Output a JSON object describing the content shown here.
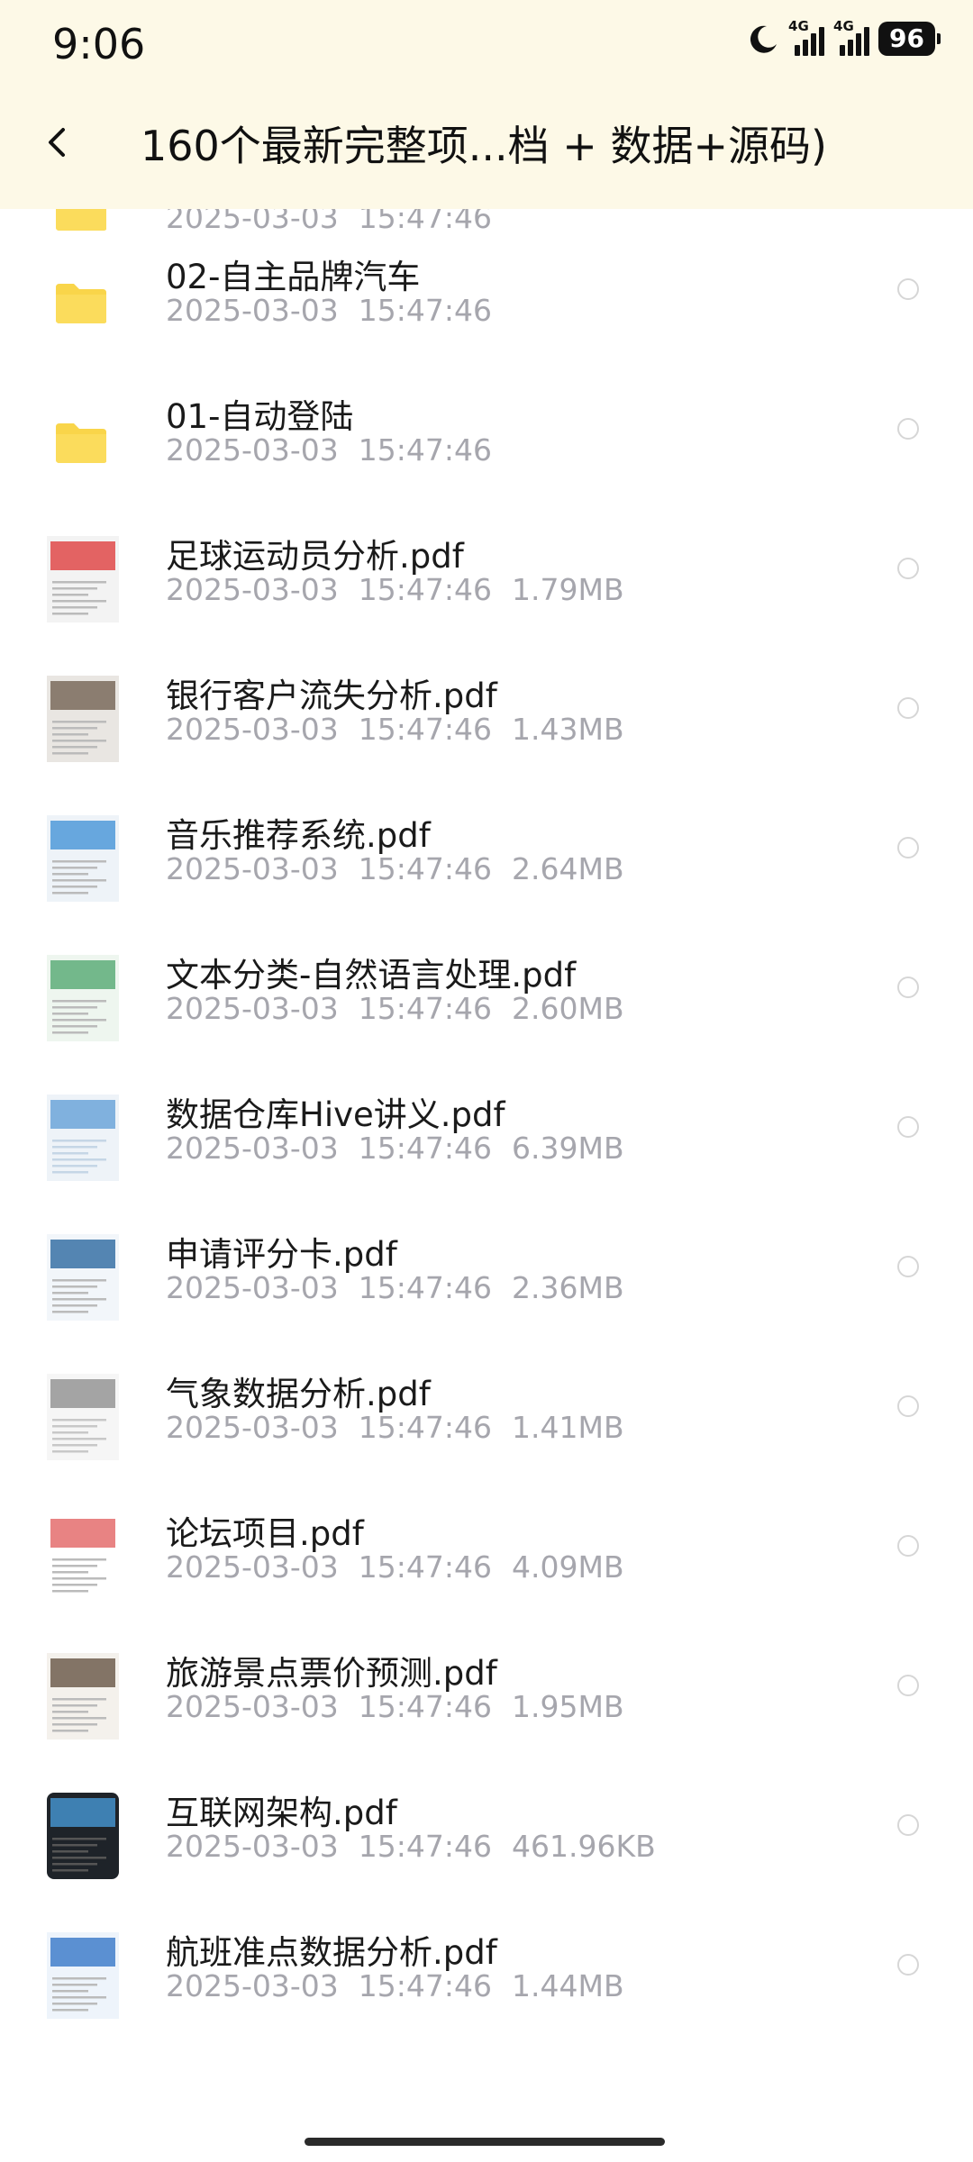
{
  "status_bar": {
    "time": "9:06",
    "signal1_label": "4G",
    "signal2_label": "4G",
    "battery": "96"
  },
  "header": {
    "title": "160个最新完整项...档 + 数据+源码)"
  },
  "files": [
    {
      "name": "",
      "date": "2025-03-03",
      "time": "15:47:46",
      "size": "",
      "type": "folder"
    },
    {
      "name": "02-自主品牌汽车",
      "date": "2025-03-03",
      "time": "15:47:46",
      "size": "",
      "type": "folder"
    },
    {
      "name": "01-自动登陆",
      "date": "2025-03-03",
      "time": "15:47:46",
      "size": "",
      "type": "folder"
    },
    {
      "name": "足球运动员分析.pdf",
      "date": "2025-03-03",
      "time": "15:47:46",
      "size": "1.79MB",
      "type": "pdf"
    },
    {
      "name": "银行客户流失分析.pdf",
      "date": "2025-03-03",
      "time": "15:47:46",
      "size": "1.43MB",
      "type": "pdf"
    },
    {
      "name": "音乐推荐系统.pdf",
      "date": "2025-03-03",
      "time": "15:47:46",
      "size": "2.64MB",
      "type": "pdf"
    },
    {
      "name": "文本分类-自然语言处理.pdf",
      "date": "2025-03-03",
      "time": "15:47:46",
      "size": "2.60MB",
      "type": "pdf"
    },
    {
      "name": "数据仓库Hive讲义.pdf",
      "date": "2025-03-03",
      "time": "15:47:46",
      "size": "6.39MB",
      "type": "pdf"
    },
    {
      "name": "申请评分卡.pdf",
      "date": "2025-03-03",
      "time": "15:47:46",
      "size": "2.36MB",
      "type": "pdf"
    },
    {
      "name": "气象数据分析.pdf",
      "date": "2025-03-03",
      "time": "15:47:46",
      "size": "1.41MB",
      "type": "pdf"
    },
    {
      "name": "论坛项目.pdf",
      "date": "2025-03-03",
      "time": "15:47:46",
      "size": "4.09MB",
      "type": "pdf"
    },
    {
      "name": "旅游景点票价预测.pdf",
      "date": "2025-03-03",
      "time": "15:47:46",
      "size": "1.95MB",
      "type": "pdf"
    },
    {
      "name": "互联网架构.pdf",
      "date": "2025-03-03",
      "time": "15:47:46",
      "size": "461.96KB",
      "type": "pdf"
    },
    {
      "name": "航班准点数据分析.pdf",
      "date": "2025-03-03",
      "time": "15:47:46",
      "size": "1.44MB",
      "type": "pdf"
    }
  ],
  "colors": {
    "header_bg": "#fdf9e7",
    "folder_yellow": "#f9d54a",
    "meta_gray": "#a6a6ad"
  }
}
